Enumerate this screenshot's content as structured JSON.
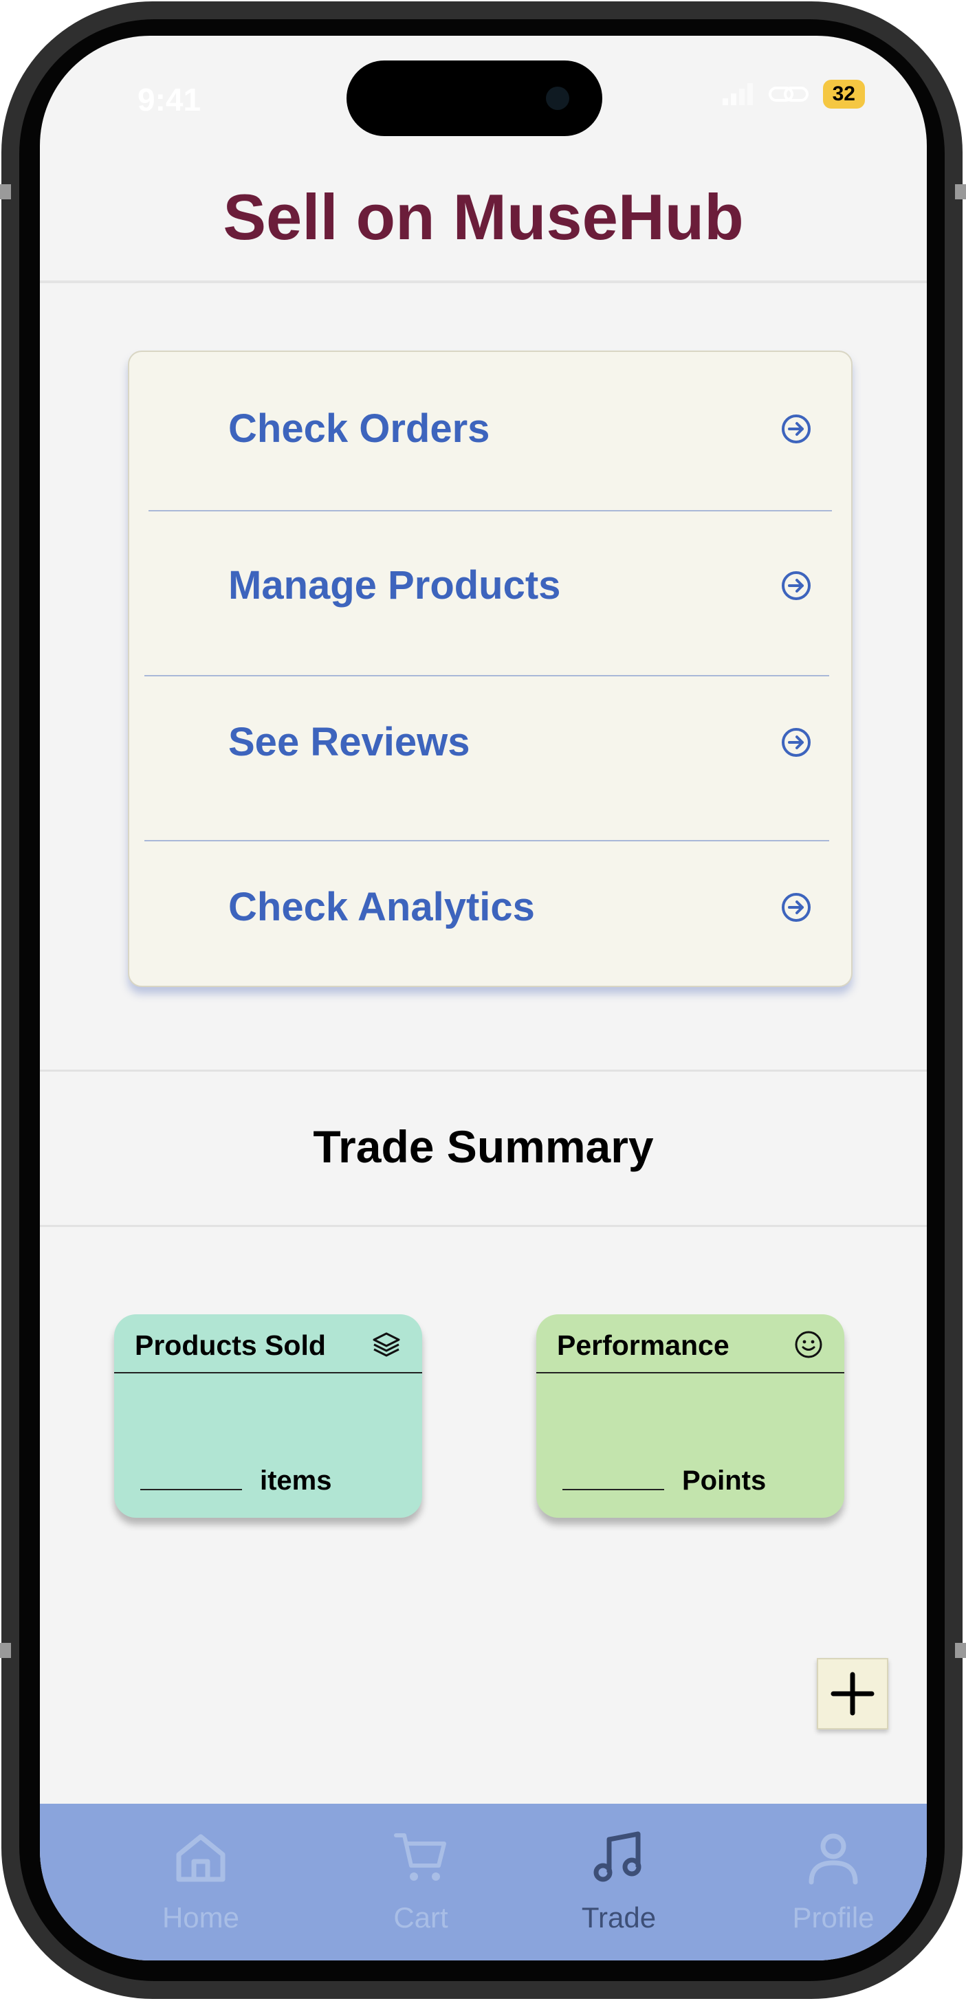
{
  "status_bar": {
    "time": "9:41",
    "battery": "32"
  },
  "header": {
    "title": "Sell on MuseHub"
  },
  "menu": {
    "items": [
      {
        "label": "Check Orders"
      },
      {
        "label": "Manage Products"
      },
      {
        "label": "See Reviews"
      },
      {
        "label": "Check Analytics"
      }
    ]
  },
  "summary": {
    "title": "Trade Summary",
    "cards": [
      {
        "title": "Products Sold",
        "unit": "items",
        "icon": "layers-icon",
        "color": "#b1e5d3"
      },
      {
        "title": "Performance",
        "unit": "Points",
        "icon": "smile-icon",
        "color": "#c3e4ad"
      }
    ]
  },
  "fab": {
    "icon": "plus-icon"
  },
  "tabbar": {
    "items": [
      {
        "label": "Home",
        "icon": "home-icon"
      },
      {
        "label": "Cart",
        "icon": "cart-icon"
      },
      {
        "label": "Trade",
        "icon": "music-note-icon",
        "active": true
      },
      {
        "label": "Profile",
        "icon": "profile-icon"
      }
    ]
  },
  "colors": {
    "accent": "#3d64bd",
    "title": "#6b1d3a",
    "tabbar": "#8aa4dc"
  }
}
